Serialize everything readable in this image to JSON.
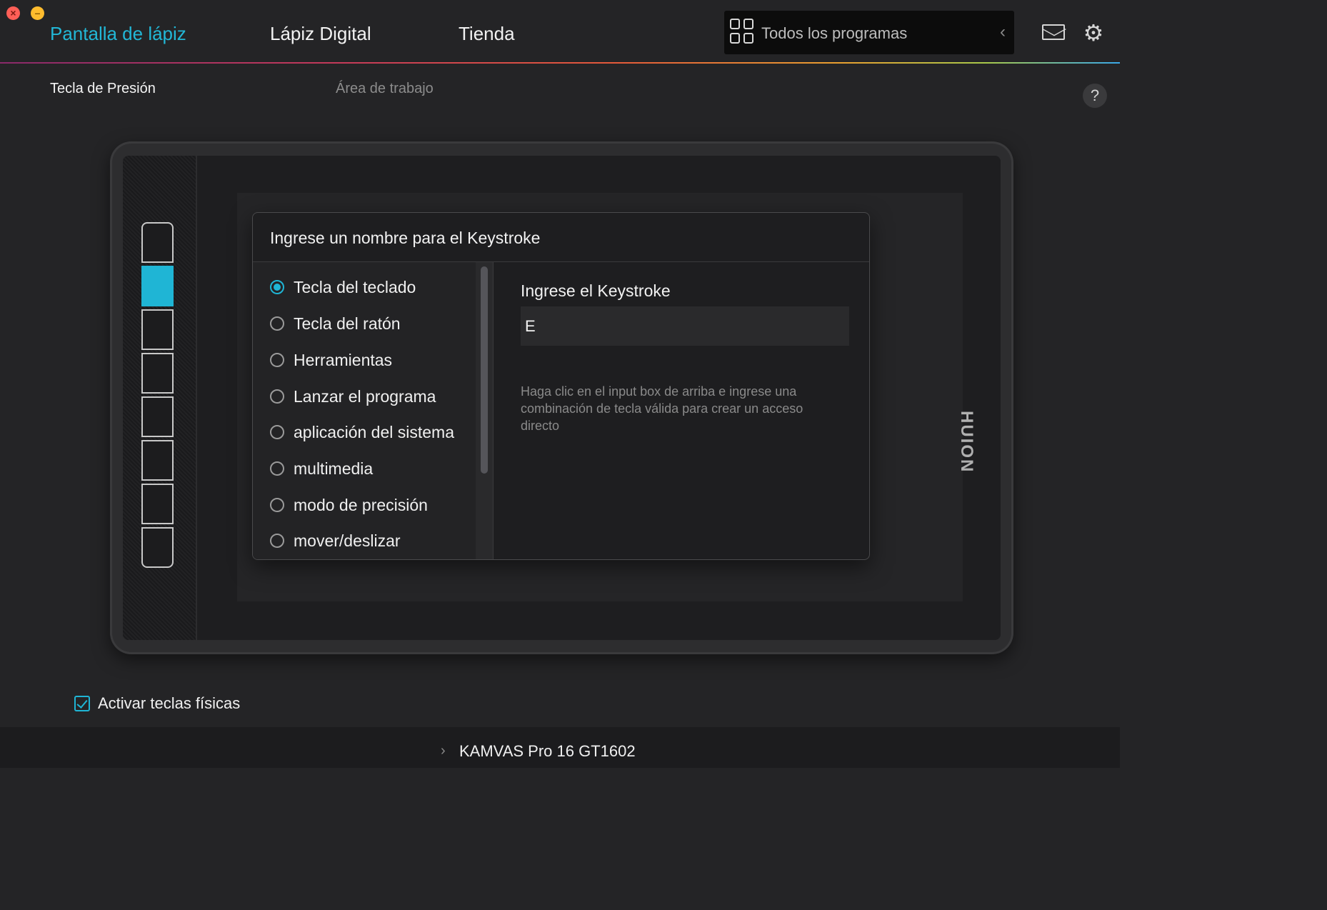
{
  "window": {
    "close_symbol": "×",
    "minimize_symbol": "–"
  },
  "nav": {
    "tabs": [
      {
        "label": "Pantalla de lápiz",
        "active": true
      },
      {
        "label": "Lápiz Digital",
        "active": false
      },
      {
        "label": "Tienda",
        "active": false
      }
    ],
    "program_select": {
      "label": "Todos los programas",
      "icon": "grid-icon"
    },
    "mail_icon": "mail-icon",
    "settings_icon": "gear-icon",
    "accent_color": "#22b7d6"
  },
  "subtabs": [
    {
      "label": "Tecla de Presión",
      "active": true
    },
    {
      "label": "Área de trabajo",
      "active": false
    }
  ],
  "help_label": "?",
  "tablet": {
    "brand_logo": "HUION",
    "express_keys": 8,
    "active_key_index": 1
  },
  "dialog": {
    "title": "Ingrese un nombre para el Keystroke",
    "options": [
      {
        "label": "Tecla del teclado",
        "selected": true
      },
      {
        "label": "Tecla del ratón",
        "selected": false
      },
      {
        "label": "Herramientas",
        "selected": false
      },
      {
        "label": "Lanzar el programa",
        "selected": false
      },
      {
        "label": "aplicación del sistema",
        "selected": false
      },
      {
        "label": "multimedia",
        "selected": false
      },
      {
        "label": "modo de precisión",
        "selected": false
      },
      {
        "label": "mover/deslizar",
        "selected": false
      }
    ],
    "keystroke_label": "Ingrese el Keystroke",
    "keystroke_value": "E",
    "hint": "Haga clic en el input box de arriba e ingrese una combinación de tecla válida para crear un acceso directo"
  },
  "enable_keys": {
    "label": "Activar teclas físicas",
    "checked": true
  },
  "footer": {
    "device": "KAMVAS Pro 16 GT1602"
  }
}
